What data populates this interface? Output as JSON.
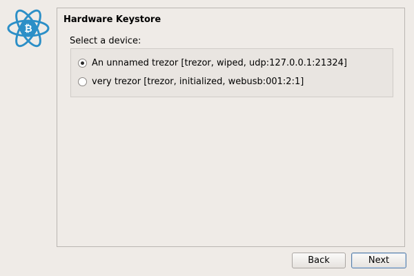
{
  "wizard": {
    "title": "Hardware Keystore",
    "select_label": "Select a device:",
    "devices": [
      {
        "label": "An unnamed trezor [trezor, wiped, udp:127.0.0.1:21324]",
        "selected": true
      },
      {
        "label": "very trezor [trezor, initialized, webusb:001:2:1]",
        "selected": false
      }
    ]
  },
  "buttons": {
    "back_label": "Back",
    "next_label": "Next"
  },
  "colors": {
    "window_bg": "#efebe7",
    "logo_blue": "#2c8fc7",
    "default_button_border": "#5a7fa8"
  },
  "icons": {
    "logo": "electrum-bitcoin-logo-icon"
  }
}
